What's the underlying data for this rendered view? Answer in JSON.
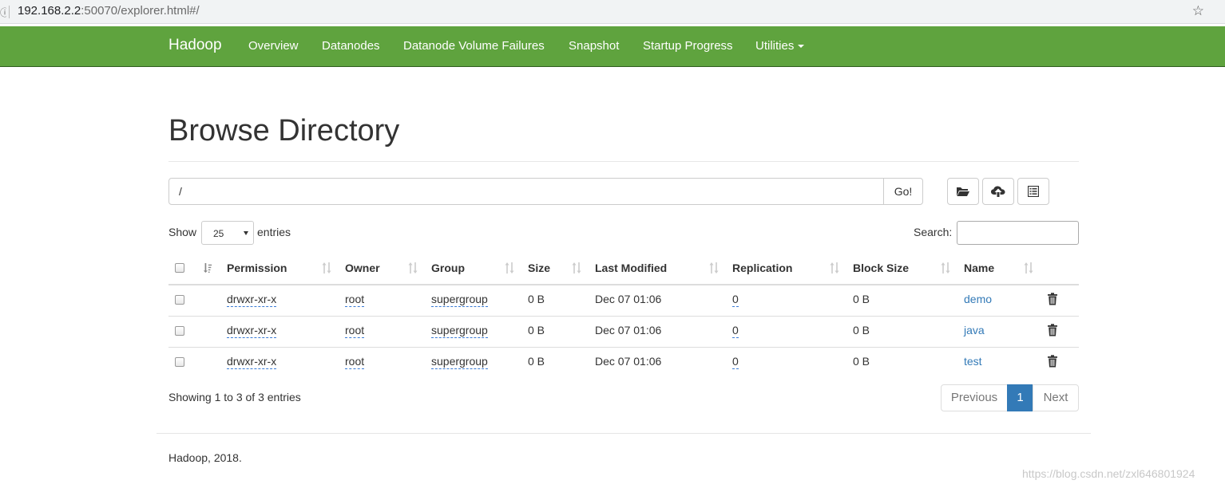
{
  "browser": {
    "url_host": "192.168.2.2",
    "url_rest": ":50070/explorer.html#/"
  },
  "navbar": {
    "brand": "Hadoop",
    "items": [
      "Overview",
      "Datanodes",
      "Datanode Volume Failures",
      "Snapshot",
      "Startup Progress",
      "Utilities"
    ]
  },
  "page": {
    "title": "Browse Directory",
    "path_value": "/",
    "go_label": "Go!"
  },
  "table_controls": {
    "show_label": "Show",
    "entries_value": "25",
    "entries_label": "entries",
    "search_label": "Search:"
  },
  "table": {
    "columns": [
      "Permission",
      "Owner",
      "Group",
      "Size",
      "Last Modified",
      "Replication",
      "Block Size",
      "Name"
    ],
    "rows": [
      {
        "permission": "drwxr-xr-x",
        "owner": "root",
        "group": "supergroup",
        "size": "0 B",
        "last_modified": "Dec 07 01:06",
        "replication": "0",
        "block_size": "0 B",
        "name": "demo"
      },
      {
        "permission": "drwxr-xr-x",
        "owner": "root",
        "group": "supergroup",
        "size": "0 B",
        "last_modified": "Dec 07 01:06",
        "replication": "0",
        "block_size": "0 B",
        "name": "java"
      },
      {
        "permission": "drwxr-xr-x",
        "owner": "root",
        "group": "supergroup",
        "size": "0 B",
        "last_modified": "Dec 07 01:06",
        "replication": "0",
        "block_size": "0 B",
        "name": "test"
      }
    ]
  },
  "pagination": {
    "info": "Showing 1 to 3 of 3 entries",
    "previous": "Previous",
    "current": "1",
    "next": "Next"
  },
  "footer": {
    "text": "Hadoop, 2018."
  },
  "watermark": "https://blog.csdn.net/zxl646801924",
  "colors": {
    "navbar": "#5fa33e",
    "link": "#337ab7",
    "active_page": "#337ab7"
  }
}
